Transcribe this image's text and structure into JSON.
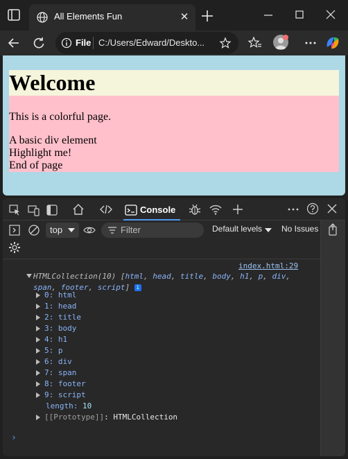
{
  "browser": {
    "tab_title": "All Elements Fun",
    "scheme_label": "File",
    "url": "C:/Users/Edward/Deskto...",
    "colors": {
      "chrome": "#202020",
      "accent": "#4f9bf0"
    }
  },
  "page": {
    "heading": "Welcome",
    "paragraph": "This is a colorful page.",
    "div_text": "A basic div element",
    "span_text": "Highlight me!",
    "footer_text": "End of page",
    "colors": {
      "body": "#add8e6",
      "h1_bg": "#f5f5dc",
      "pink": "#ffc0cb"
    }
  },
  "devtools": {
    "console_tab": "Console",
    "context": "top",
    "filter_placeholder": "Filter",
    "levels": "Default levels",
    "issues": "No Issues",
    "source_link": "index.html:29",
    "collection": {
      "head_prefix": "HTMLCollection(10) [",
      "items_inline_1": [
        "html",
        "head",
        "title",
        "body",
        "h1",
        "p",
        "div"
      ],
      "items_inline_2": [
        "span",
        "footer",
        "script"
      ],
      "info_badge": "i",
      "entries": [
        {
          "index": "0:",
          "tag": "html"
        },
        {
          "index": "1:",
          "tag": "head"
        },
        {
          "index": "2:",
          "tag": "title"
        },
        {
          "index": "3:",
          "tag": "body"
        },
        {
          "index": "4:",
          "tag": "h1"
        },
        {
          "index": "5:",
          "tag": "p"
        },
        {
          "index": "6:",
          "tag": "div"
        },
        {
          "index": "7:",
          "tag": "span"
        },
        {
          "index": "8:",
          "tag": "footer"
        },
        {
          "index": "9:",
          "tag": "script"
        }
      ],
      "length_key": "length:",
      "length_value": "10",
      "proto_key": "[[Prototype]]",
      "proto_value": "HTMLCollection"
    },
    "prompt": "›"
  }
}
